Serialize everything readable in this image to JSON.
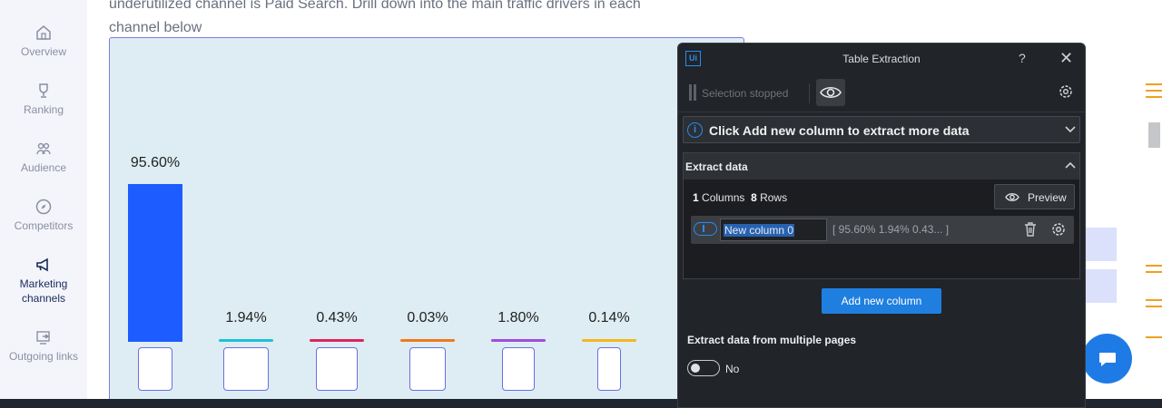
{
  "sidebar": {
    "items": [
      {
        "label": "Overview",
        "icon": "home-icon"
      },
      {
        "label": "Ranking",
        "icon": "trophy-icon"
      },
      {
        "label": "Audience",
        "icon": "people-icon"
      },
      {
        "label": "Competitors",
        "icon": "compass-icon"
      },
      {
        "label": "Marketing channels",
        "icon": "megaphone-icon",
        "active": true
      },
      {
        "label": "Outgoing links",
        "icon": "external-link-icon"
      }
    ]
  },
  "main": {
    "intro_line1": "underutilized channel is Paid Search. Drill down into the main traffic drivers in each",
    "intro_line2": "channel below"
  },
  "chart_data": {
    "type": "bar",
    "values": [
      95.6,
      1.94,
      0.43,
      0.03,
      1.8,
      0.14
    ],
    "labels": [
      "95.60%",
      "1.94%",
      "0.43%",
      "0.03%",
      "1.80%",
      "0.14%"
    ],
    "colors": [
      "#1d5cff",
      "#20c0d8",
      "#e0245e",
      "#f07a1a",
      "#a04be0",
      "#f2b81c"
    ],
    "ylim": [
      0,
      100
    ]
  },
  "dialog": {
    "title": "Table Extraction",
    "logo": "Ui",
    "help": "?",
    "close": "✕",
    "selection_status": "Selection stopped",
    "banner": "Click Add new column to extract more data",
    "extract_section": "Extract data",
    "columns_count": "1",
    "columns_label": "Columns",
    "rows_count": "8",
    "rows_label": "Rows",
    "preview_label": "Preview",
    "column_name": "New column 0",
    "column_preview": "[ 95.60% 1.94% 0.43...    ]",
    "add_column_label": "Add new column",
    "multi_pages_label": "Extract data from multiple pages",
    "multi_pages_value": "No"
  },
  "colors": {
    "accent": "#1f7fe0",
    "dialog_bg": "#212428",
    "chart_bg": "#deedf3",
    "chat_button": "#1e7be6"
  }
}
